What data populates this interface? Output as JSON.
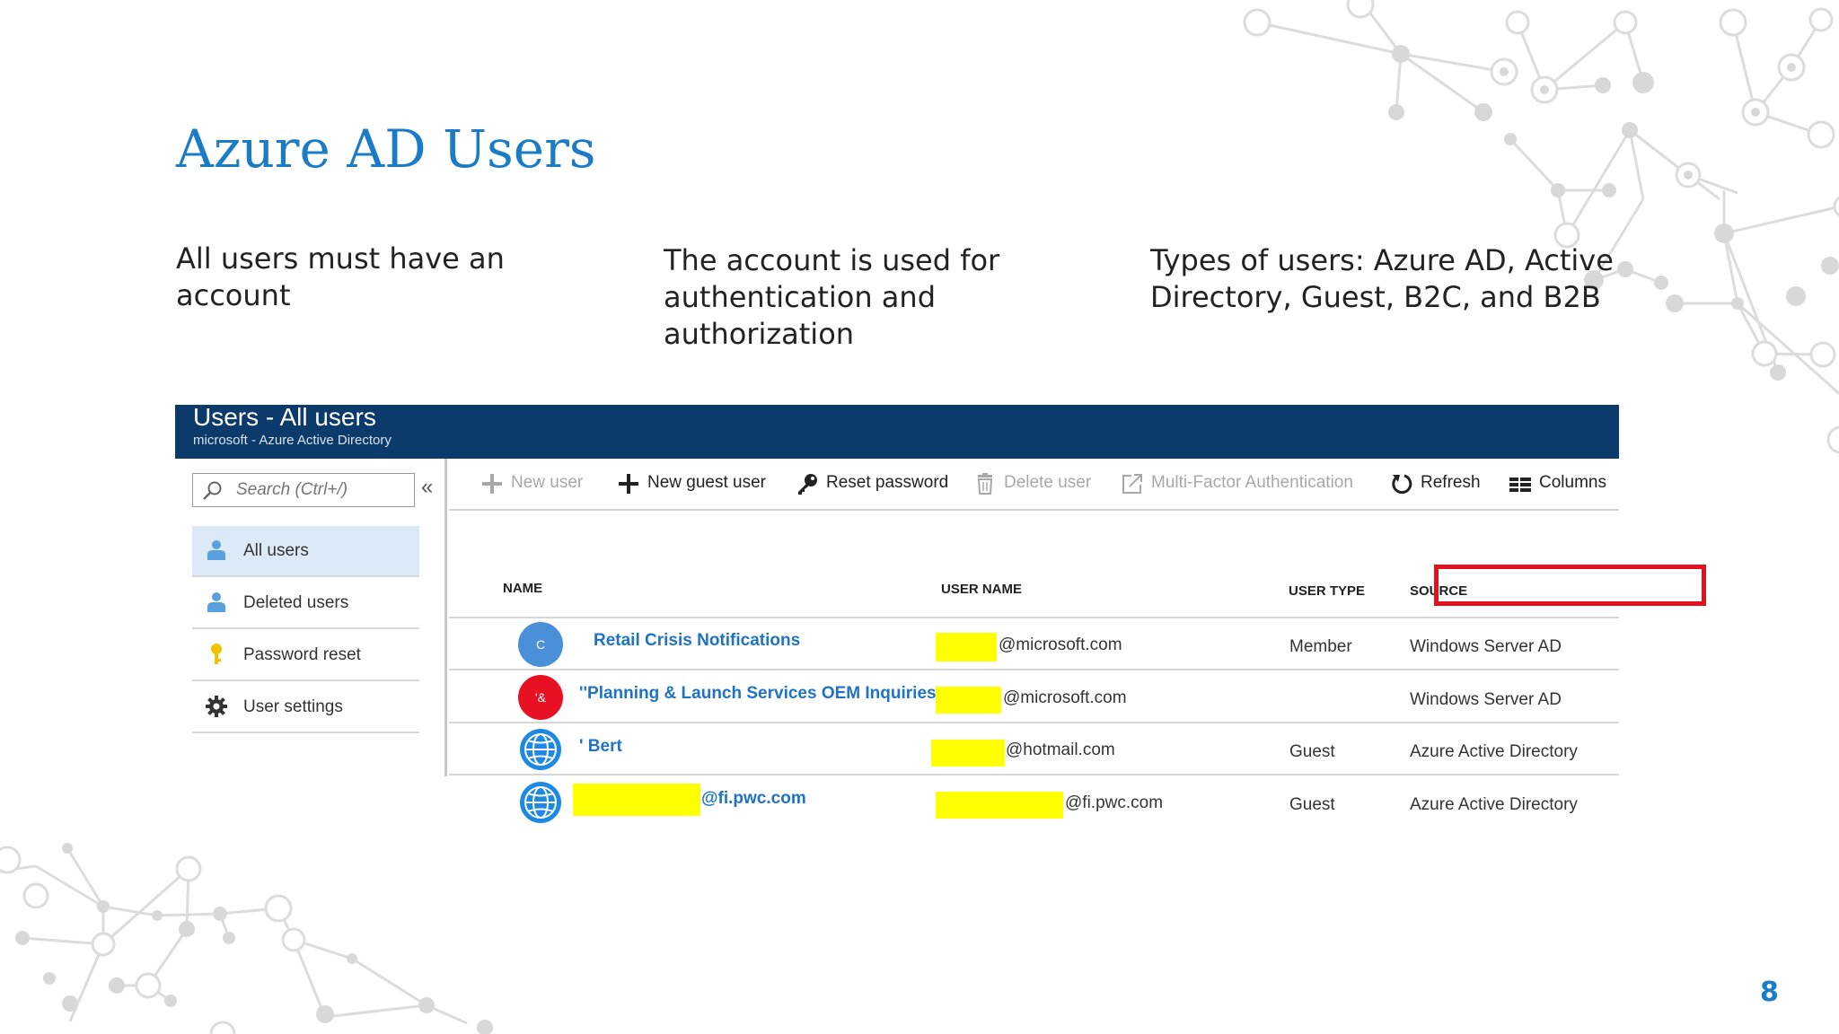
{
  "slide": {
    "title": "Azure AD Users",
    "bullets": [
      "All users must have an account",
      "The account is used for authentication and authorization",
      "Types of users: Azure AD, Active Directory, Guest, B2C, and B2B"
    ],
    "page_number": "8",
    "accent_color": "#1a7bc7"
  },
  "screenshot": {
    "header": {
      "title": "Users - All users",
      "subtitle": "microsoft - Azure Active Directory",
      "color": "#0b3a6b"
    },
    "search": {
      "placeholder": "Search (Ctrl+/)",
      "icon": "search-icon"
    },
    "collapse_label": "«",
    "nav": [
      {
        "label": "All users",
        "icon": "user-icon",
        "active": true
      },
      {
        "label": "Deleted users",
        "icon": "user-icon",
        "active": false
      },
      {
        "label": "Password reset",
        "icon": "key-icon",
        "active": false
      },
      {
        "label": "User settings",
        "icon": "gear-icon",
        "active": false
      }
    ],
    "toolbar": [
      {
        "label": "New user",
        "icon": "plus-icon",
        "enabled": false
      },
      {
        "label": "New guest user",
        "icon": "plus-icon",
        "enabled": true
      },
      {
        "label": "Reset password",
        "icon": "key-icon",
        "enabled": true
      },
      {
        "label": "Delete user",
        "icon": "trash-icon",
        "enabled": false
      },
      {
        "label": "Multi-Factor Authentication",
        "icon": "external-link-icon",
        "enabled": false
      },
      {
        "label": "Refresh",
        "icon": "refresh-icon",
        "enabled": true
      },
      {
        "label": "Columns",
        "icon": "columns-icon",
        "enabled": true
      }
    ],
    "table": {
      "columns": [
        "NAME",
        "USER NAME",
        "USER TYPE",
        "SOURCE"
      ],
      "highlighted_columns": [
        "USER TYPE",
        "SOURCE"
      ],
      "highlight_color": "#e3101d",
      "rows": [
        {
          "avatar": "C",
          "avatar_color": "#4a90d9",
          "name": "Retail Crisis Notifications",
          "user_name_suffix": "@microsoft.com",
          "user_type": "Member",
          "source": "Windows Server AD"
        },
        {
          "avatar": "'&",
          "avatar_color": "#e81123",
          "name": "''Planning & Launch Services OEM Inquiries",
          "user_name_suffix": "@microsoft.com",
          "user_type": "",
          "source": "Windows Server AD"
        },
        {
          "avatar": "globe-icon",
          "avatar_color": "#1e88e5",
          "name": "' Bert",
          "user_name_suffix": "@hotmail.com",
          "user_type": "Guest",
          "source": "Azure Active Directory"
        },
        {
          "avatar": "globe-icon",
          "avatar_color": "#1e88e5",
          "name": "@fi.pwc.com",
          "user_name_suffix": "@fi.pwc.com",
          "user_type": "Guest",
          "source": "Azure Active Directory"
        }
      ],
      "redaction_color": "#ffff00"
    }
  }
}
